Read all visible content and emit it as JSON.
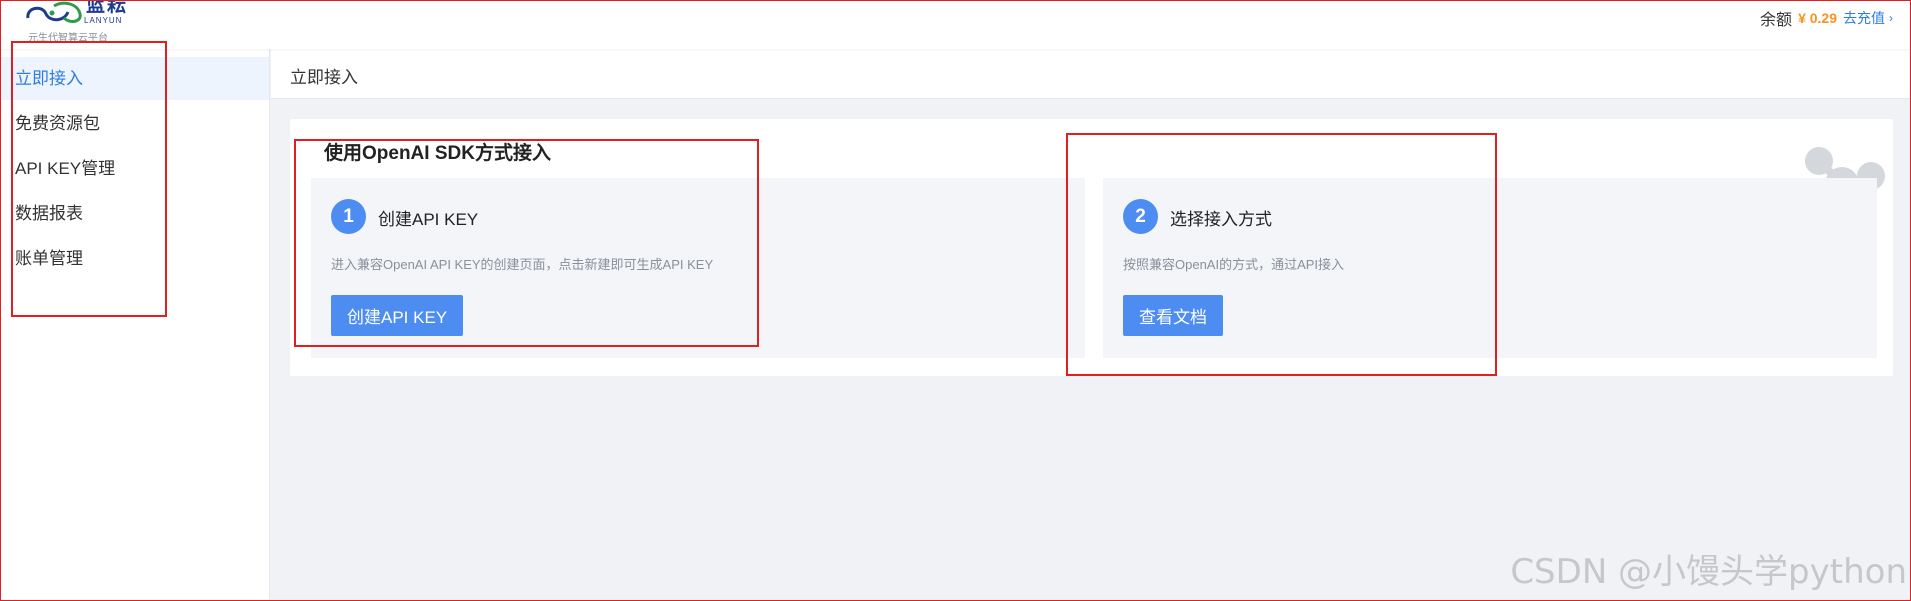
{
  "header": {
    "logo_cn": "蓝耘",
    "logo_en": "LANYUN",
    "logo_slogan": "元生代智算云平台",
    "balance_label": "余额",
    "balance_amount": "¥ 0.29",
    "recharge_label": "去充值",
    "chevron_glyph": "›"
  },
  "sidebar": {
    "items": [
      {
        "label": "立即接入",
        "active": true
      },
      {
        "label": "免费资源包"
      },
      {
        "label": "API KEY管理"
      },
      {
        "label": "数据报表"
      },
      {
        "label": "账单管理"
      }
    ]
  },
  "main": {
    "title": "立即接入",
    "card": {
      "title": "使用OpenAI SDK方式接入",
      "steps": [
        {
          "num": "1",
          "title": "创建API KEY",
          "desc": "进入兼容OpenAI API KEY的创建页面，点击新建即可生成API KEY",
          "button": "创建API KEY"
        },
        {
          "num": "2",
          "title": "选择接入方式",
          "desc": "按照兼容OpenAI的方式，通过API接入",
          "button": "查看文档"
        }
      ]
    }
  },
  "watermark": "CSDN @小馒头学python",
  "colors": {
    "primary": "#4d8cf0",
    "link": "#2f7de1",
    "price": "#f7931e",
    "annotation": "#e02020"
  }
}
